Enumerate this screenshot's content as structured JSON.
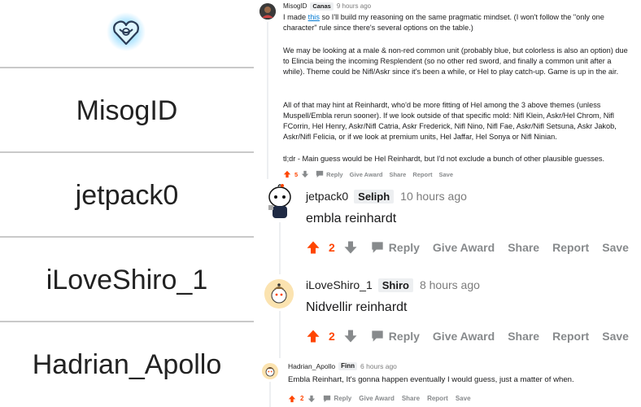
{
  "left_panel": {
    "logo_icon": "heart-emblem-icon",
    "names": [
      "MisogID",
      "jetpack0",
      "iLoveShiro_1",
      "Hadrian_Apollo"
    ]
  },
  "comments": [
    {
      "user": "MisogID",
      "flair": "Canas",
      "time": "9 hours ago",
      "paragraphs": {
        "p1_before": "I made ",
        "p1_link": "this",
        "p1_after": " so I'll build my reasoning on the same pragmatic mindset. (I won't follow the \"only one character\" rule since there's several options on the table.)",
        "p2": "We may be looking at a male & non-red common unit (probably blue, but colorless is also an option) due to Elincia being the incoming Resplendent (so no other red sword, and finally a common unit after a while). Theme could be Nifl/Askr since it's been a while, or Hel to play catch-up. Game is up in the air.",
        "p3": "All of that may hint at Reinhardt, who'd be more fitting of Hel among the 3 above themes (unless Muspell/Embla rerun sooner). If we look outside of that specific mold: Nifl Klein, Askr/Hel Chrom, Nifl FCorrin, Hel Henry, Askr/Nifl Catria, Askr Frederick, Nifl Nino, Nifl Fae, Askr/Nifl Setsuna, Askr Jakob, Askr/Nifl Felicia, or if we look at premium units, Hel Jaffar, Hel Sonya or Nifl Ninian.",
        "p4": "tl;dr - Main guess would be Hel Reinhardt, but I'd not exclude a bunch of other plausible guesses."
      },
      "votes": "5",
      "actions": [
        "Reply",
        "Give Award",
        "Share",
        "Report",
        "Save"
      ]
    },
    {
      "user": "jetpack0",
      "flair": "Seliph",
      "time": "10 hours ago",
      "body": "embla reinhardt",
      "votes": "2",
      "actions": [
        "Reply",
        "Give Award",
        "Share",
        "Report",
        "Save"
      ]
    },
    {
      "user": "iLoveShiro_1",
      "flair": "Shiro",
      "time": "8 hours ago",
      "body": "Nidvellir reinhardt",
      "votes": "2",
      "actions": [
        "Reply",
        "Give Award",
        "Share",
        "Report",
        "Save"
      ]
    },
    {
      "user": "Hadrian_Apollo",
      "flair": "Finn",
      "time": "6 hours ago",
      "body": "Embla Reinhart, It's gonna happen eventually I would guess, just a matter of when.",
      "votes": "2",
      "actions": [
        "Reply",
        "Give Award",
        "Share",
        "Report",
        "Save"
      ]
    }
  ],
  "colors": {
    "upvote": "#ff4500",
    "muted": "#878a8c",
    "link": "#0079d3",
    "flair_bg": "#edeff1",
    "divider": "#c9c9c9"
  }
}
